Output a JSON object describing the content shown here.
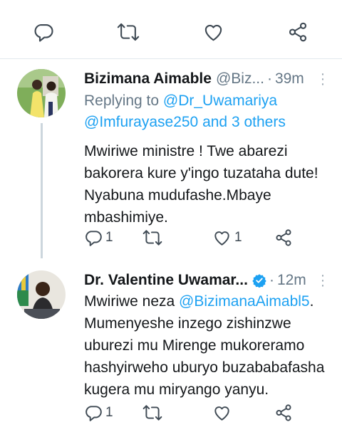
{
  "top_actions": {
    "reply_icon": "reply-icon",
    "retweet_icon": "retweet-icon",
    "like_icon": "heart-icon",
    "share_icon": "share-icon"
  },
  "tweets": [
    {
      "name": "Bizimana Aimable",
      "handle": "@Biz...",
      "dot": "·",
      "time": "39m",
      "reply_prefix": "Replying to",
      "reply_user1": "@Dr_Uwamariya",
      "reply_user2": "@Imfurayase250",
      "reply_and": "and",
      "reply_others": "3 others",
      "body_lines": [
        "Mwiriwe ministre ! Twe abarezi",
        "bakorera kure y'ingo tuzataha dute!",
        "Nyabuna mudufashe.Mbaye",
        "mbashimiye."
      ],
      "reply_count": "1",
      "retweet_count": "",
      "like_count": "1"
    },
    {
      "name": "Dr. Valentine Uwamar...",
      "verified": true,
      "dot": "·",
      "time": "12m",
      "body_first": "Mwiriwe neza ",
      "body_mention": "@BizimanaAimabl5",
      "body_first_end": ".",
      "body_lines": [
        "Mumenyeshe inzego zishinzwe",
        "uburezi mu Mirenge mukoreramo",
        "hashyirweho uburyo buzababafasha",
        "kugera mu miryango yanyu."
      ],
      "reply_count": "1",
      "retweet_count": "",
      "like_count": ""
    }
  ],
  "colors": {
    "accent": "#1da1f2",
    "secondary_text": "#657786",
    "divider": "#e1e8ed",
    "icon": "#3f4a54"
  }
}
